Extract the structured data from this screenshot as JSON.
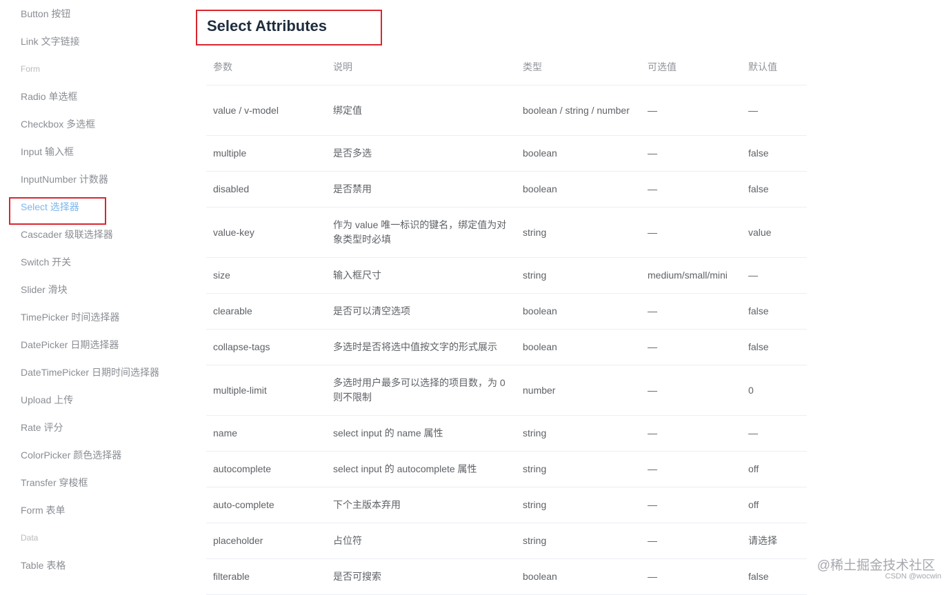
{
  "sidebar": {
    "items": [
      {
        "label": "Button 按钮",
        "kind": "item"
      },
      {
        "label": "Link 文字链接",
        "kind": "item"
      },
      {
        "label": "Form",
        "kind": "group"
      },
      {
        "label": "Radio 单选框",
        "kind": "item"
      },
      {
        "label": "Checkbox 多选框",
        "kind": "item"
      },
      {
        "label": "Input 输入框",
        "kind": "item"
      },
      {
        "label": "InputNumber 计数器",
        "kind": "item"
      },
      {
        "label": "Select 选择器",
        "kind": "item",
        "active": true
      },
      {
        "label": "Cascader 级联选择器",
        "kind": "item"
      },
      {
        "label": "Switch 开关",
        "kind": "item"
      },
      {
        "label": "Slider 滑块",
        "kind": "item"
      },
      {
        "label": "TimePicker 时间选择器",
        "kind": "item"
      },
      {
        "label": "DatePicker 日期选择器",
        "kind": "item"
      },
      {
        "label": "DateTimePicker 日期时间选择器",
        "kind": "item"
      },
      {
        "label": "Upload 上传",
        "kind": "item"
      },
      {
        "label": "Rate 评分",
        "kind": "item"
      },
      {
        "label": "ColorPicker 颜色选择器",
        "kind": "item"
      },
      {
        "label": "Transfer 穿梭框",
        "kind": "item"
      },
      {
        "label": "Form 表单",
        "kind": "item"
      },
      {
        "label": "Data",
        "kind": "group"
      },
      {
        "label": "Table 表格",
        "kind": "item"
      }
    ]
  },
  "main": {
    "title": "Select Attributes",
    "table": {
      "headers": [
        "参数",
        "说明",
        "类型",
        "可选值",
        "默认值"
      ],
      "rows": [
        [
          "value / v-model",
          "绑定值",
          "boolean / string / number",
          "—",
          "—"
        ],
        [
          "multiple",
          "是否多选",
          "boolean",
          "—",
          "false"
        ],
        [
          "disabled",
          "是否禁用",
          "boolean",
          "—",
          "false"
        ],
        [
          "value-key",
          "作为 value 唯一标识的键名，绑定值为对象类型时必填",
          "string",
          "—",
          "value"
        ],
        [
          "size",
          "输入框尺寸",
          "string",
          "medium/small/mini",
          "—"
        ],
        [
          "clearable",
          "是否可以清空选项",
          "boolean",
          "—",
          "false"
        ],
        [
          "collapse-tags",
          "多选时是否将选中值按文字的形式展示",
          "boolean",
          "—",
          "false"
        ],
        [
          "multiple-limit",
          "多选时用户最多可以选择的项目数，为 0 则不限制",
          "number",
          "—",
          "0"
        ],
        [
          "name",
          "select input 的 name 属性",
          "string",
          "—",
          "—"
        ],
        [
          "autocomplete",
          "select input 的 autocomplete 属性",
          "string",
          "—",
          "off"
        ],
        [
          "auto-complete",
          "下个主版本弃用",
          "string",
          "—",
          "off"
        ],
        [
          "placeholder",
          "占位符",
          "string",
          "—",
          "请选择"
        ],
        [
          "filterable",
          "是否可搜索",
          "boolean",
          "—",
          "false"
        ]
      ]
    }
  },
  "watermark": {
    "text": "@稀土掘金技术社区",
    "credit": "CSDN @wocwin"
  },
  "colors": {
    "highlight_border": "#d9252e",
    "active_link": "#7ab7ee",
    "title_text": "#1f2d3d"
  }
}
